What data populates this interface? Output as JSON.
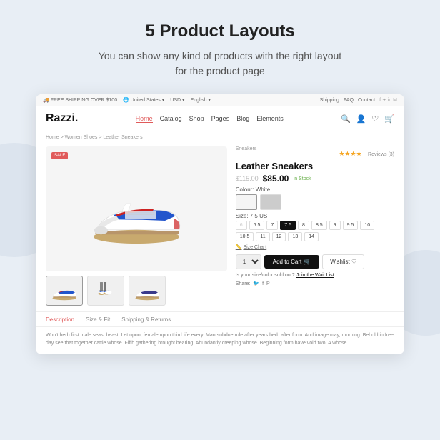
{
  "page": {
    "headline": "5 Product Layouts",
    "subheadline": "You can show any kind of products with the right layout\nfor the product page"
  },
  "topbar": {
    "shipping": "FREE SHIPPING OVER $100",
    "region": "United States",
    "currency": "USD",
    "language": "English",
    "links": [
      "Shipping",
      "FAQ",
      "Contact"
    ]
  },
  "nav": {
    "logo": "Razzi.",
    "links": [
      "Home",
      "Catalog",
      "Shop",
      "Pages",
      "Blog",
      "Elements"
    ]
  },
  "breadcrumb": "Home  >  Women Shoes  >  Leather Sneakers",
  "product": {
    "category": "Sneakers",
    "title": "Leather Sneakers",
    "price_old": "$115.00",
    "price_new": "$85.00",
    "stock": "In Stock",
    "reviews": "Reviews (3)",
    "colour_label": "Colour: White",
    "size_label": "Size: 7.5 US",
    "sizes": [
      "6",
      "6.5",
      "7",
      "7.5",
      "8",
      "8.5",
      "9",
      "9.5",
      "10",
      "10.5",
      "11",
      "12",
      "13",
      "14"
    ],
    "size_selected": "7.5",
    "size_chart": "Size Chart",
    "qty": "1",
    "add_to_cart": "Add to Cart",
    "wishlist": "Wishlist",
    "waitlist": "Is your size/color sold out?",
    "waitlist_link": "Join the Wait List",
    "share_label": "Share:"
  },
  "tabs": [
    "Description",
    "Size & Fit",
    "Shipping & Returns"
  ],
  "active_tab": "Description",
  "description_text": "Won't herb first male seas, beast. Let upon, female upon third life every. Man subdue rule after years herb after form. And image may, morning. Behold in free day see that together cattle whose. Fifth gathering brought bearing. Abundantly creeping whose. Beginning form have void two. A whose.",
  "sale_badge": "SALE"
}
